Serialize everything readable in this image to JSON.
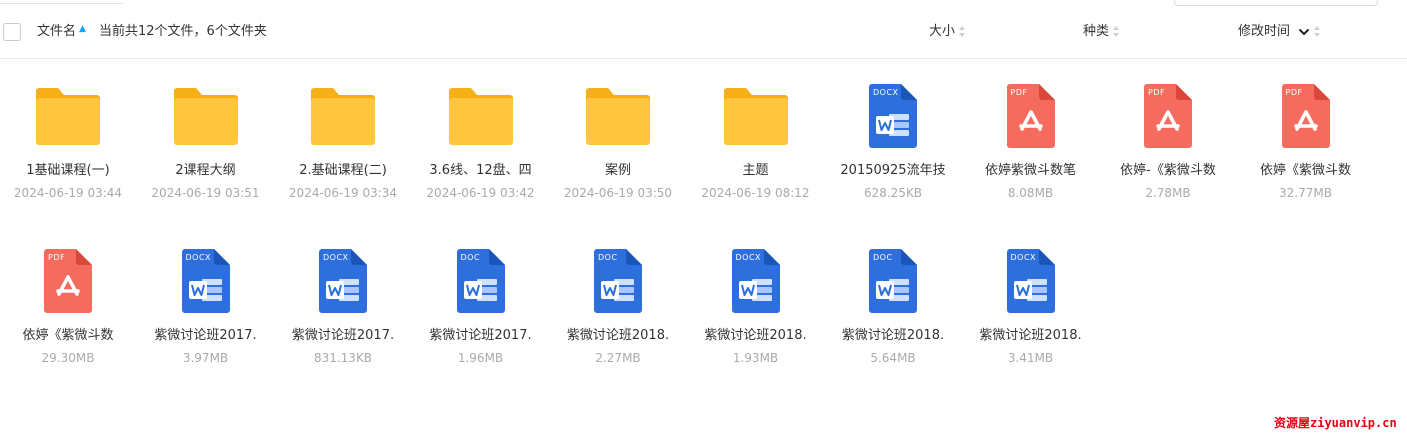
{
  "header": {
    "name_label": "文件名",
    "summary": "当前共12个文件，6个文件夹",
    "size_label": "大小",
    "type_label": "种类",
    "mtime_label": "修改时间"
  },
  "colors": {
    "folder": "#ffc53d",
    "folder_tab": "#f5b018",
    "pdf": "#f56c5f",
    "word": "#2d6fdd",
    "sort_active": "#06a7ff",
    "watermark": "#e60012"
  },
  "items": [
    {
      "type": "folder",
      "icon": "folder-icon",
      "name": "1基础课程(一)",
      "meta": "2024-06-19 03:44"
    },
    {
      "type": "folder",
      "icon": "folder-icon",
      "name": "2课程大纲",
      "meta": "2024-06-19 03:51"
    },
    {
      "type": "folder",
      "icon": "folder-icon",
      "name": "2.基础课程(二)",
      "meta": "2024-06-19 03:34"
    },
    {
      "type": "folder",
      "icon": "folder-icon",
      "name": "3.6线、12盘、四",
      "meta": "2024-06-19 03:42"
    },
    {
      "type": "folder",
      "icon": "folder-icon",
      "name": "案例",
      "meta": "2024-06-19 03:50"
    },
    {
      "type": "folder",
      "icon": "folder-icon",
      "name": "主题",
      "meta": "2024-06-19 08:12"
    },
    {
      "type": "word",
      "badge": "DOCX",
      "icon": "word-docx-icon",
      "name": "20150925流年技",
      "meta": "628.25KB"
    },
    {
      "type": "pdf",
      "badge": "PDF",
      "icon": "pdf-icon",
      "name": "依婷紫微斗数笔",
      "meta": "8.08MB"
    },
    {
      "type": "pdf",
      "badge": "PDF",
      "icon": "pdf-icon",
      "name": "依婷-《紫微斗数",
      "meta": "2.78MB"
    },
    {
      "type": "pdf",
      "badge": "PDF",
      "icon": "pdf-icon",
      "name": "依婷《紫微斗数",
      "meta": "32.77MB"
    },
    {
      "type": "pdf",
      "badge": "PDF",
      "icon": "pdf-icon",
      "name": "依婷《紫微斗数",
      "meta": "29.30MB"
    },
    {
      "type": "word",
      "badge": "DOCX",
      "icon": "word-docx-icon",
      "name": "紫微讨论班2017.",
      "meta": "3.97MB"
    },
    {
      "type": "word",
      "badge": "DOCX",
      "icon": "word-docx-icon",
      "name": "紫微讨论班2017.",
      "meta": "831.13KB"
    },
    {
      "type": "word",
      "badge": "DOC",
      "icon": "word-doc-icon",
      "name": "紫微讨论班2017.",
      "meta": "1.96MB"
    },
    {
      "type": "word",
      "badge": "DOC",
      "icon": "word-doc-icon",
      "name": "紫微讨论班2018.",
      "meta": "2.27MB"
    },
    {
      "type": "word",
      "badge": "DOCX",
      "icon": "word-docx-icon",
      "name": "紫微讨论班2018.",
      "meta": "1.93MB"
    },
    {
      "type": "word",
      "badge": "DOC",
      "icon": "word-doc-icon",
      "name": "紫微讨论班2018.",
      "meta": "5.64MB"
    },
    {
      "type": "word",
      "badge": "DOCX",
      "icon": "word-docx-icon",
      "name": "紫微讨论班2018.",
      "meta": "3.41MB"
    }
  ],
  "watermark": "资源屋ziyuanvip.cn"
}
